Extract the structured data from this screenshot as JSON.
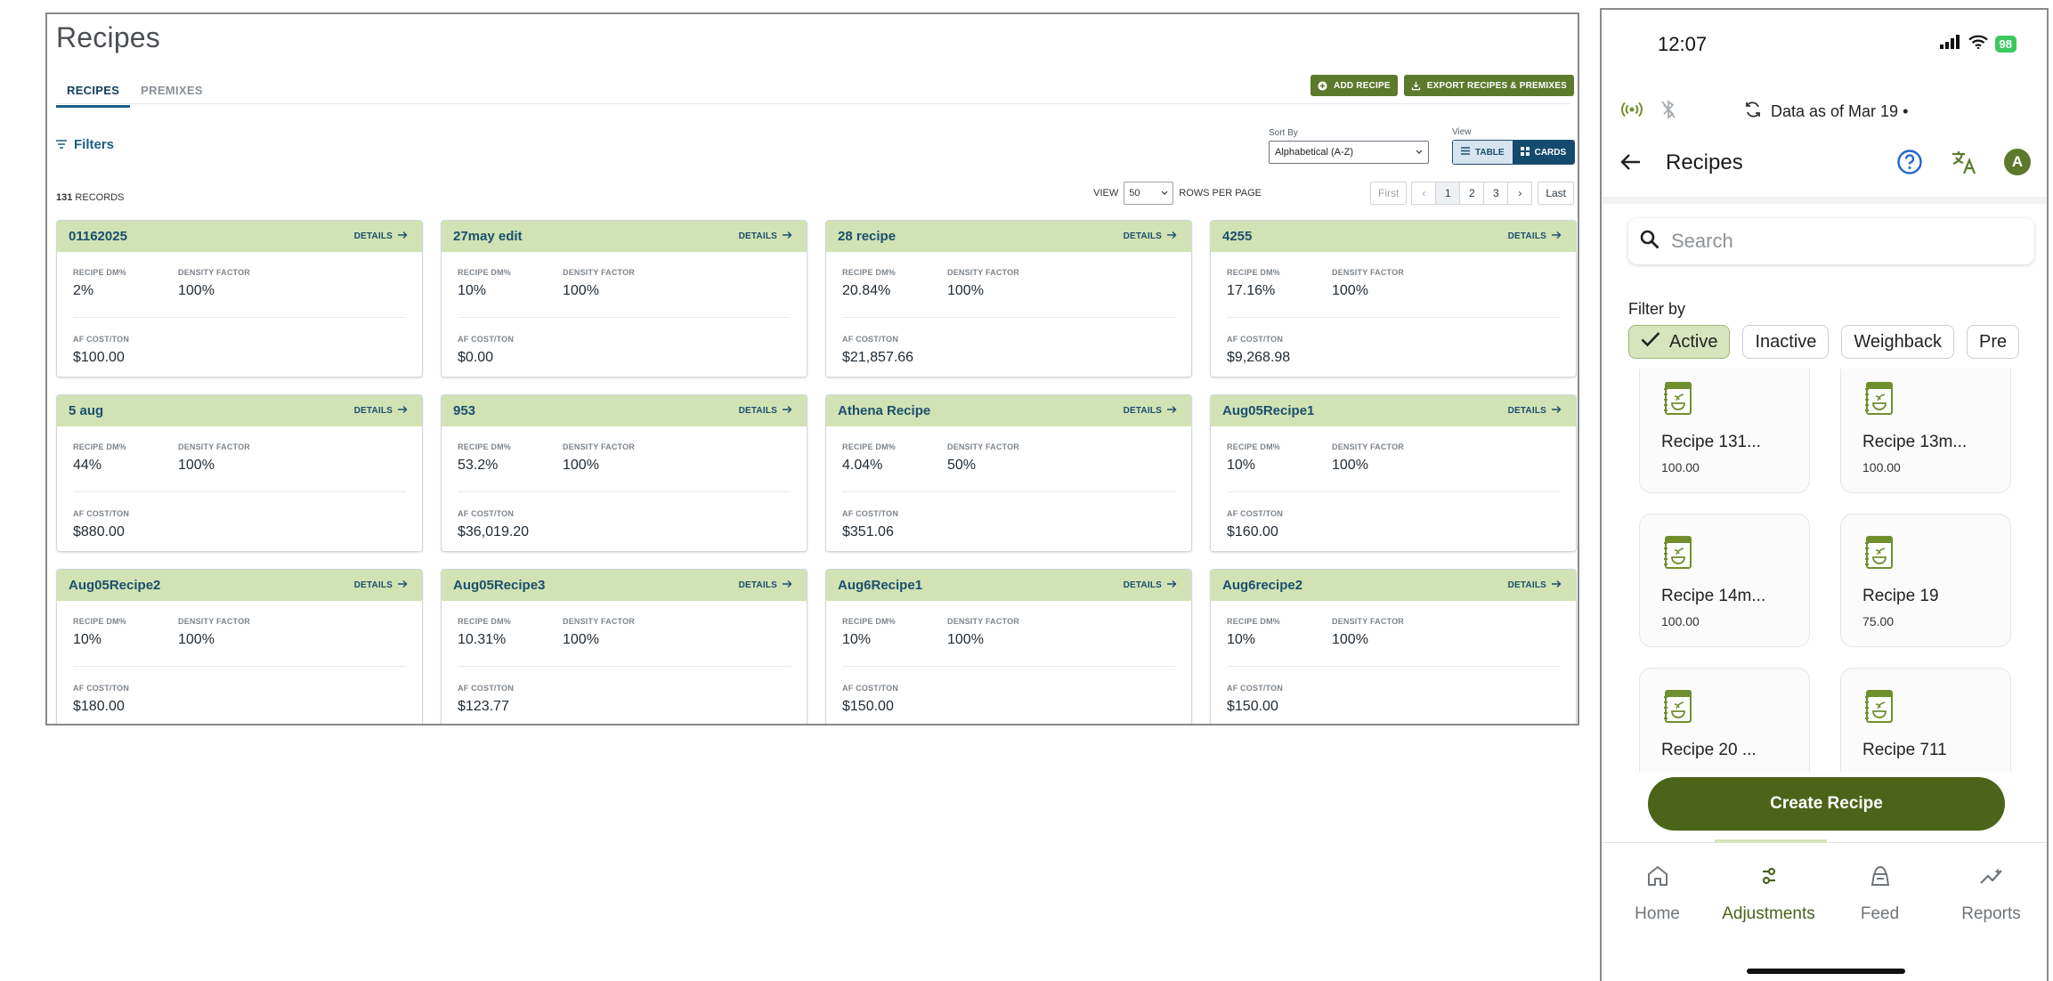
{
  "desktop": {
    "title": "Recipes",
    "tabs": [
      {
        "label": "RECIPES",
        "active": true
      },
      {
        "label": "PREMIXES",
        "active": false
      }
    ],
    "actions": {
      "add": "ADD RECIPE",
      "export": "EXPORT RECIPES & PREMIXES"
    },
    "filters_label": "Filters",
    "sort": {
      "label": "Sort By",
      "value": "Alphabetical (A-Z)"
    },
    "view": {
      "label": "View",
      "table": "TABLE",
      "cards": "CARDS",
      "selected": "cards"
    },
    "records": {
      "count": "131",
      "suffix": "RECORDS"
    },
    "pager": {
      "view_label": "VIEW",
      "rows_per_page": "50",
      "rows_suffix": "ROWS PER PAGE",
      "first": "First",
      "prev": "‹",
      "pages": [
        "1",
        "2",
        "3"
      ],
      "next": "›",
      "last": "Last",
      "current": "1"
    },
    "labels": {
      "details": "DETAILS",
      "dm": "RECIPE DM%",
      "density": "DENSITY FACTOR",
      "cost": "AF COST/TON"
    },
    "cards": [
      {
        "name": "01162025",
        "dm": "2%",
        "density": "100%",
        "cost": "$100.00"
      },
      {
        "name": "27may edit",
        "dm": "10%",
        "density": "100%",
        "cost": "$0.00"
      },
      {
        "name": "28 recipe",
        "dm": "20.84%",
        "density": "100%",
        "cost": "$21,857.66"
      },
      {
        "name": "4255",
        "dm": "17.16%",
        "density": "100%",
        "cost": "$9,268.98"
      },
      {
        "name": "5 aug",
        "dm": "44%",
        "density": "100%",
        "cost": "$880.00"
      },
      {
        "name": "953",
        "dm": "53.2%",
        "density": "100%",
        "cost": "$36,019.20"
      },
      {
        "name": "Athena Recipe",
        "dm": "4.04%",
        "density": "50%",
        "cost": "$351.06"
      },
      {
        "name": "Aug05Recipe1",
        "dm": "10%",
        "density": "100%",
        "cost": "$160.00"
      },
      {
        "name": "Aug05Recipe2",
        "dm": "10%",
        "density": "100%",
        "cost": "$180.00"
      },
      {
        "name": "Aug05Recipe3",
        "dm": "10.31%",
        "density": "100%",
        "cost": "$123.77"
      },
      {
        "name": "Aug6Recipe1",
        "dm": "10%",
        "density": "100%",
        "cost": "$150.00"
      },
      {
        "name": "Aug6recipe2",
        "dm": "10%",
        "density": "100%",
        "cost": "$150.00"
      }
    ]
  },
  "mobile": {
    "status": {
      "time": "12:07",
      "battery": "98"
    },
    "sync_text": "Data as of Mar 19 •",
    "header": {
      "title": "Recipes",
      "avatar": "A"
    },
    "search": {
      "placeholder": "Search",
      "value": ""
    },
    "filter_label": "Filter by",
    "chips": [
      {
        "label": "Active",
        "active": true
      },
      {
        "label": "Inactive",
        "active": false
      },
      {
        "label": "Weighback",
        "active": false
      },
      {
        "label": "Pre",
        "active": false
      }
    ],
    "tiles": [
      {
        "name": "Recipe 131...",
        "value": "100.00"
      },
      {
        "name": "Recipe 13m...",
        "value": "100.00"
      },
      {
        "name": "Recipe 14m...",
        "value": "100.00"
      },
      {
        "name": "Recipe 19",
        "value": "75.00"
      },
      {
        "name": "Recipe 20 ...",
        "value": ""
      },
      {
        "name": "Recipe 711",
        "value": ""
      }
    ],
    "create_button": "Create Recipe",
    "nav": [
      {
        "label": "Home",
        "icon": "home-icon",
        "active": false
      },
      {
        "label": "Adjustments",
        "icon": "adjustments-icon",
        "active": true
      },
      {
        "label": "Feed",
        "icon": "feed-icon",
        "active": false
      },
      {
        "label": "Reports",
        "icon": "reports-icon",
        "active": false
      }
    ],
    "colors": {
      "brand_green": "#4b6419",
      "chip_active": "#d7e4bd",
      "card_head": "#d1e2b4",
      "link_blue": "#1b4f6e"
    }
  }
}
